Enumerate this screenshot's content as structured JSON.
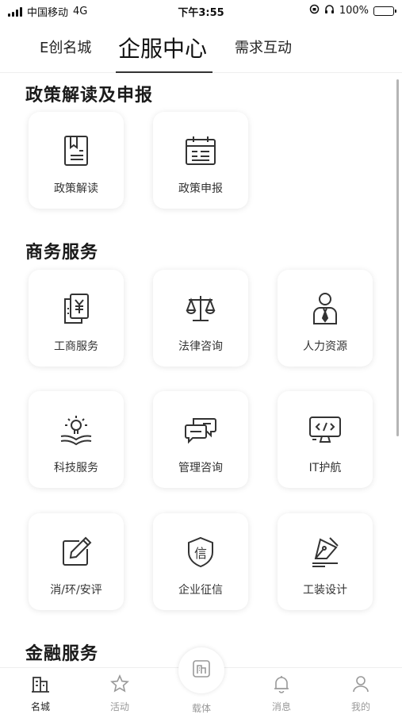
{
  "status_bar": {
    "carrier": "中国移动",
    "network": "4G",
    "time": "下午3:55",
    "battery": "100%",
    "battery_level": 1.0,
    "battery_color": "#3fc34a"
  },
  "top_tabs": [
    {
      "label": "E创名城"
    },
    {
      "label": "企服中心"
    },
    {
      "label": "需求互动"
    }
  ],
  "active_tab": "企服中心",
  "sections": [
    {
      "title": "政策解读及申报",
      "items": [
        {
          "label": "政策解读",
          "icon": "bookmark-doc-icon"
        },
        {
          "label": "政策申报",
          "icon": "calendar-icon"
        }
      ]
    },
    {
      "title": "商务服务",
      "items": [
        {
          "label": "工商服务",
          "icon": "yen-document-icon"
        },
        {
          "label": "法律咨询",
          "icon": "scales-icon"
        },
        {
          "label": "人力资源",
          "icon": "person-tie-icon"
        },
        {
          "label": "科技服务",
          "icon": "lightbulb-book-icon"
        },
        {
          "label": "管理咨询",
          "icon": "chat-bubbles-icon"
        },
        {
          "label": "IT护航",
          "icon": "code-monitor-icon"
        },
        {
          "label": "消/环/安评",
          "icon": "edit-pencil-icon"
        },
        {
          "label": "企业征信",
          "icon": "credit-shield-icon"
        },
        {
          "label": "工装设计",
          "icon": "design-pen-icon"
        }
      ]
    },
    {
      "title": "金融服务",
      "items": []
    }
  ],
  "bottom_nav": [
    {
      "label": "名城",
      "icon": "city-icon",
      "active": true
    },
    {
      "label": "活动",
      "icon": "star-icon",
      "active": false
    },
    {
      "label": "载体",
      "icon": "building-icon",
      "active": false
    },
    {
      "label": "消息",
      "icon": "bell-icon",
      "active": false
    },
    {
      "label": "我的",
      "icon": "user-icon",
      "active": false
    }
  ],
  "colors": {
    "accent": "#222222",
    "inactive": "#999999"
  }
}
